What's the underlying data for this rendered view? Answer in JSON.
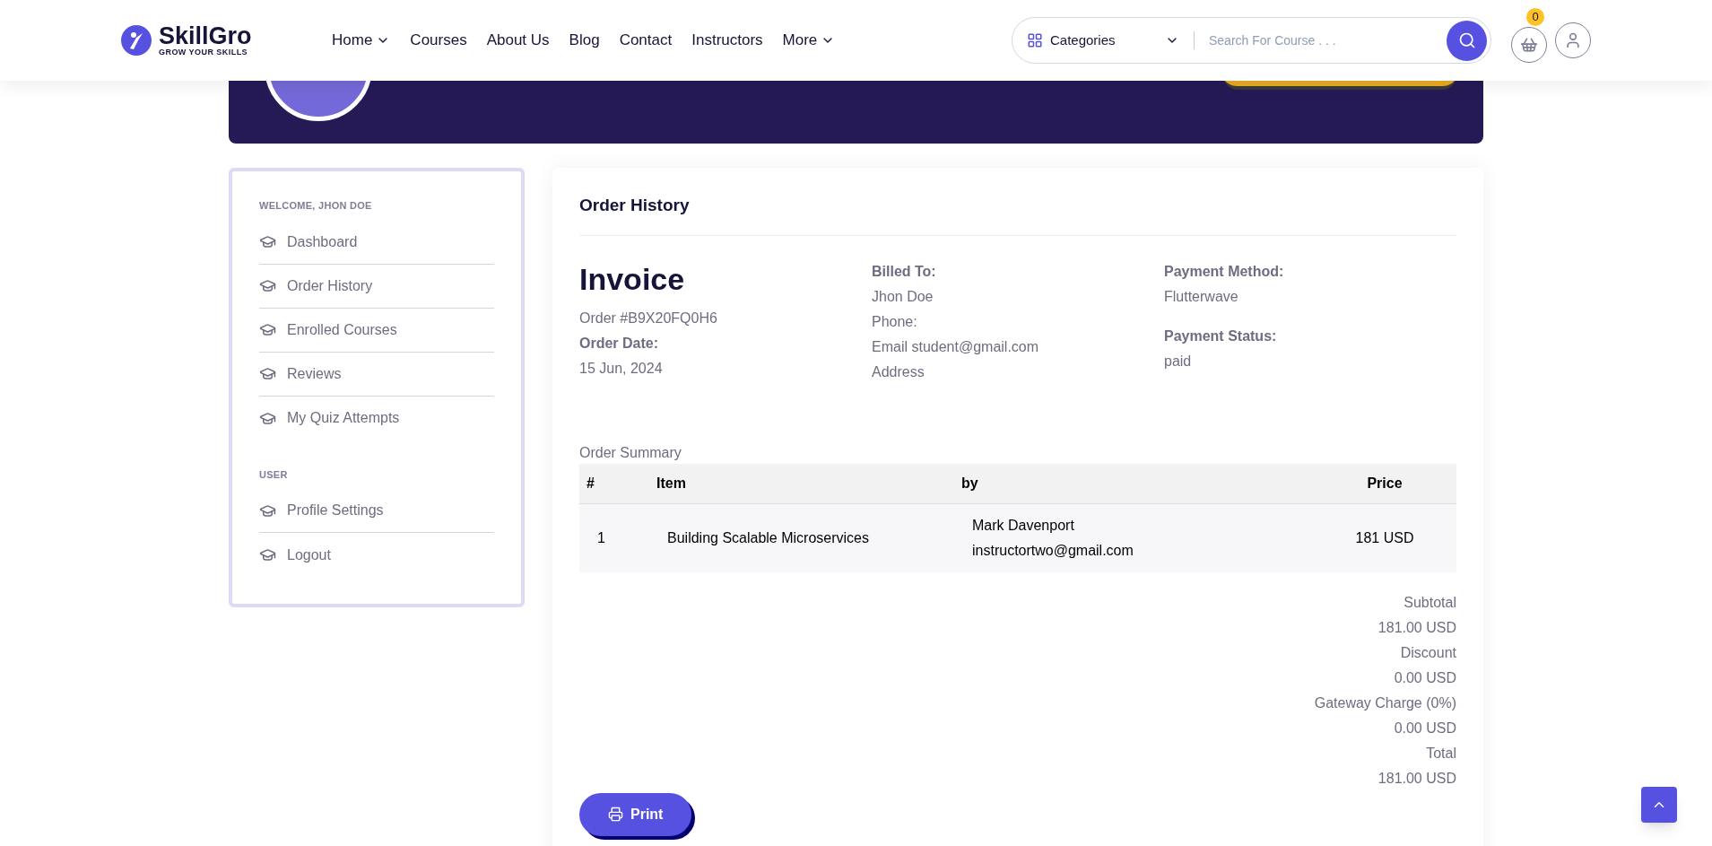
{
  "header": {
    "logo": {
      "name": "SkillGro",
      "tagline": "GROW YOUR SKILLS"
    },
    "nav": [
      {
        "label": "Home",
        "dropdown": true
      },
      {
        "label": "Courses",
        "dropdown": false
      },
      {
        "label": "About Us",
        "dropdown": false
      },
      {
        "label": "Blog",
        "dropdown": false
      },
      {
        "label": "Contact",
        "dropdown": false
      },
      {
        "label": "Instructors",
        "dropdown": false
      },
      {
        "label": "More",
        "dropdown": true
      }
    ],
    "categories": "Categories",
    "search": {
      "placeholder": "Search For Course . . ."
    },
    "cart_count": "0"
  },
  "sidebar": {
    "sections": [
      {
        "heading": "WELCOME, JHON DOE",
        "items": [
          "Dashboard",
          "Order History",
          "Enrolled Courses",
          "Reviews",
          "My Quiz Attempts"
        ]
      },
      {
        "heading": "USER",
        "items": [
          "Profile Settings",
          "Logout"
        ]
      }
    ]
  },
  "main": {
    "title": "Order History",
    "invoice": {
      "title": "Invoice",
      "order": "Order #B9X20FQ0H6",
      "date_label": "Order Date:",
      "date": "15 Jun, 2024",
      "billed_label": "Billed To:",
      "billed": [
        "Jhon Doe",
        "Phone:",
        "Email student@gmail.com",
        "Address"
      ],
      "payment_method_label": "Payment Method:",
      "payment_method": "Flutterwave",
      "payment_status_label": "Payment Status:",
      "payment_status": "paid"
    },
    "summary_label": "Order Summary",
    "table": {
      "columns": [
        "#",
        "Item",
        "by",
        "Price"
      ],
      "rows": [
        {
          "num": "1",
          "item": "Building Scalable Microservices",
          "by_name": "Mark Davenport",
          "by_email": "instructortwo@gmail.com",
          "price": "181 USD"
        }
      ]
    },
    "totals": [
      "Subtotal",
      "181.00 USD",
      "Discount",
      "0.00 USD",
      "Gateway Charge (0%)",
      "0.00 USD",
      "Total",
      "181.00 USD"
    ],
    "print_button": "Print"
  }
}
